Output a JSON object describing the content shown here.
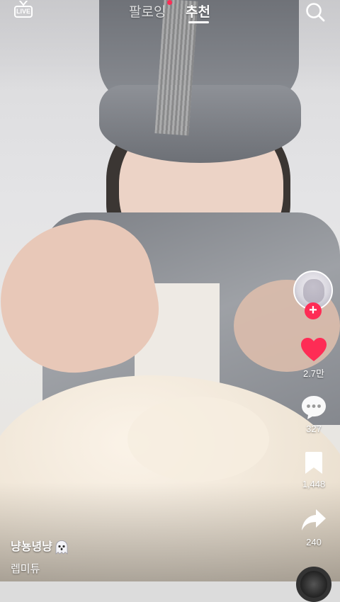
{
  "top_bar": {
    "live_label": "LIVE",
    "tabs": [
      {
        "label": "팔로잉",
        "has_dot": true
      },
      {
        "label": "추천",
        "active": true
      }
    ],
    "search_icon": "search-icon"
  },
  "right_rail": {
    "like_count": "2.7만",
    "comment_count": "327",
    "bookmark_count": "1,448",
    "share_count": "240"
  },
  "caption": {
    "username": "냥뇽녕냥",
    "username_emoji": "ghost-icon",
    "text": "렙미튜"
  },
  "colors": {
    "accent": "#fe2c55",
    "text": "#ffffff"
  }
}
